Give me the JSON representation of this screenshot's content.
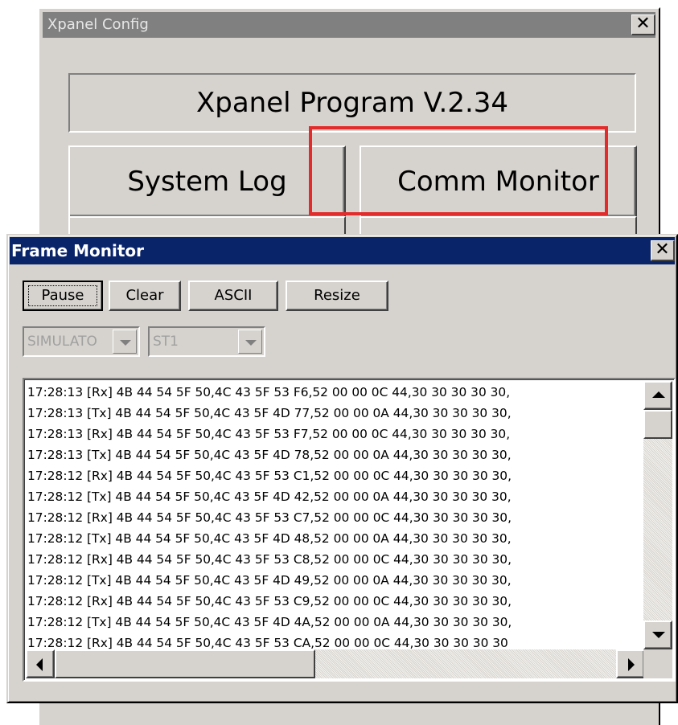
{
  "background_window": {
    "title": "Xpanel Config",
    "close_glyph": "✕",
    "version_text": "Xpanel Program V.2.34",
    "buttons": {
      "system_log": "System Log",
      "comm_monitor": "Comm Monitor"
    },
    "highlight_color": "#e32b2b"
  },
  "frame_monitor": {
    "title": "Frame Monitor",
    "close_glyph": "✕",
    "toolbar": {
      "pause": "Pause",
      "clear": "Clear",
      "ascii": "ASCII",
      "resize": "Resize"
    },
    "port_combo": {
      "value": "SIMULATO",
      "enabled": false
    },
    "station_combo": {
      "value": "ST1",
      "enabled": false
    },
    "log": [
      "17:28:13 [Rx] 4B 44 54 5F 50,4C 43 5F 53 F6,52 00 00 0C 44,30 30 30 30 30,",
      "17:28:13 [Tx] 4B 44 54 5F 50,4C 43 5F 4D 77,52 00 00 0A 44,30 30 30 30 30,",
      "17:28:13 [Rx] 4B 44 54 5F 50,4C 43 5F 53 F7,52 00 00 0C 44,30 30 30 30 30,",
      "17:28:13 [Tx] 4B 44 54 5F 50,4C 43 5F 4D 78,52 00 00 0A 44,30 30 30 30 30,",
      "17:28:12 [Rx] 4B 44 54 5F 50,4C 43 5F 53 C1,52 00 00 0C 44,30 30 30 30 30,",
      "17:28:12 [Tx] 4B 44 54 5F 50,4C 43 5F 4D 42,52 00 00 0A 44,30 30 30 30 30,",
      "17:28:12 [Rx] 4B 44 54 5F 50,4C 43 5F 53 C7,52 00 00 0C 44,30 30 30 30 30,",
      "17:28:12 [Tx] 4B 44 54 5F 50,4C 43 5F 4D 48,52 00 00 0A 44,30 30 30 30 30,",
      "17:28:12 [Rx] 4B 44 54 5F 50,4C 43 5F 53 C8,52 00 00 0C 44,30 30 30 30 30,",
      "17:28:12 [Tx] 4B 44 54 5F 50,4C 43 5F 4D 49,52 00 00 0A 44,30 30 30 30 30,",
      "17:28:12 [Rx] 4B 44 54 5F 50,4C 43 5F 53 C9,52 00 00 0C 44,30 30 30 30 30,",
      "17:28:12 [Tx] 4B 44 54 5F 50,4C 43 5F 4D 4A,52 00 00 0A 44,30 30 30 30 30,",
      "17:28:12 [Rx] 4B 44 54 5F 50,4C 43 5F 53 CA,52 00 00 0C 44,30 30 30 30 30"
    ],
    "title_bar_color": "#0a246a"
  }
}
